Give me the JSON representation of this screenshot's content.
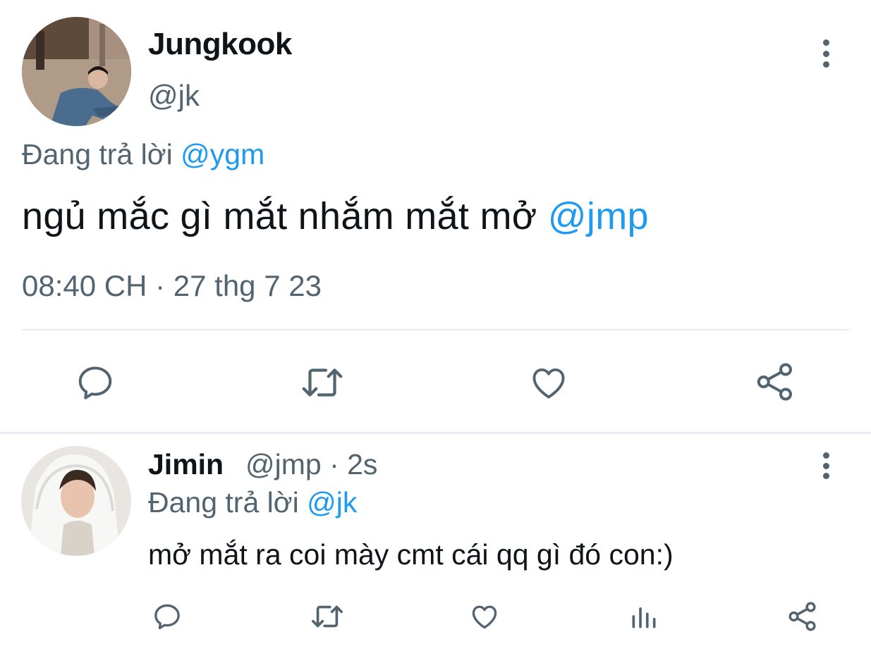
{
  "main_tweet": {
    "author": {
      "name": "Jungkook",
      "handle": "@jk"
    },
    "replying_to": {
      "prefix": "Đang trả lời",
      "mention": "@ygm"
    },
    "text": {
      "body": "ngủ mắc gì mắt nhắm mắt mở",
      "mention": "@jmp"
    },
    "timestamp": "08:40 CH · 27 thg 7 23",
    "actions": [
      "reply-icon",
      "retweet-icon",
      "like-icon",
      "share-icon"
    ]
  },
  "reply_tweet": {
    "author": {
      "name": "Jimin",
      "handle_time": "@jmp · 2s"
    },
    "replying_to": {
      "prefix": "Đang trả lời",
      "mention": "@jk"
    },
    "text": "mở mắt ra coi mày cmt cái qq gì đó con:)",
    "actions": [
      "reply-icon",
      "retweet-icon",
      "like-icon",
      "analytics-icon",
      "share-icon"
    ]
  },
  "colors": {
    "text": "#0f1419",
    "secondary": "#536471",
    "accent": "#1d9bf0",
    "divider": "#e6ecf0"
  }
}
